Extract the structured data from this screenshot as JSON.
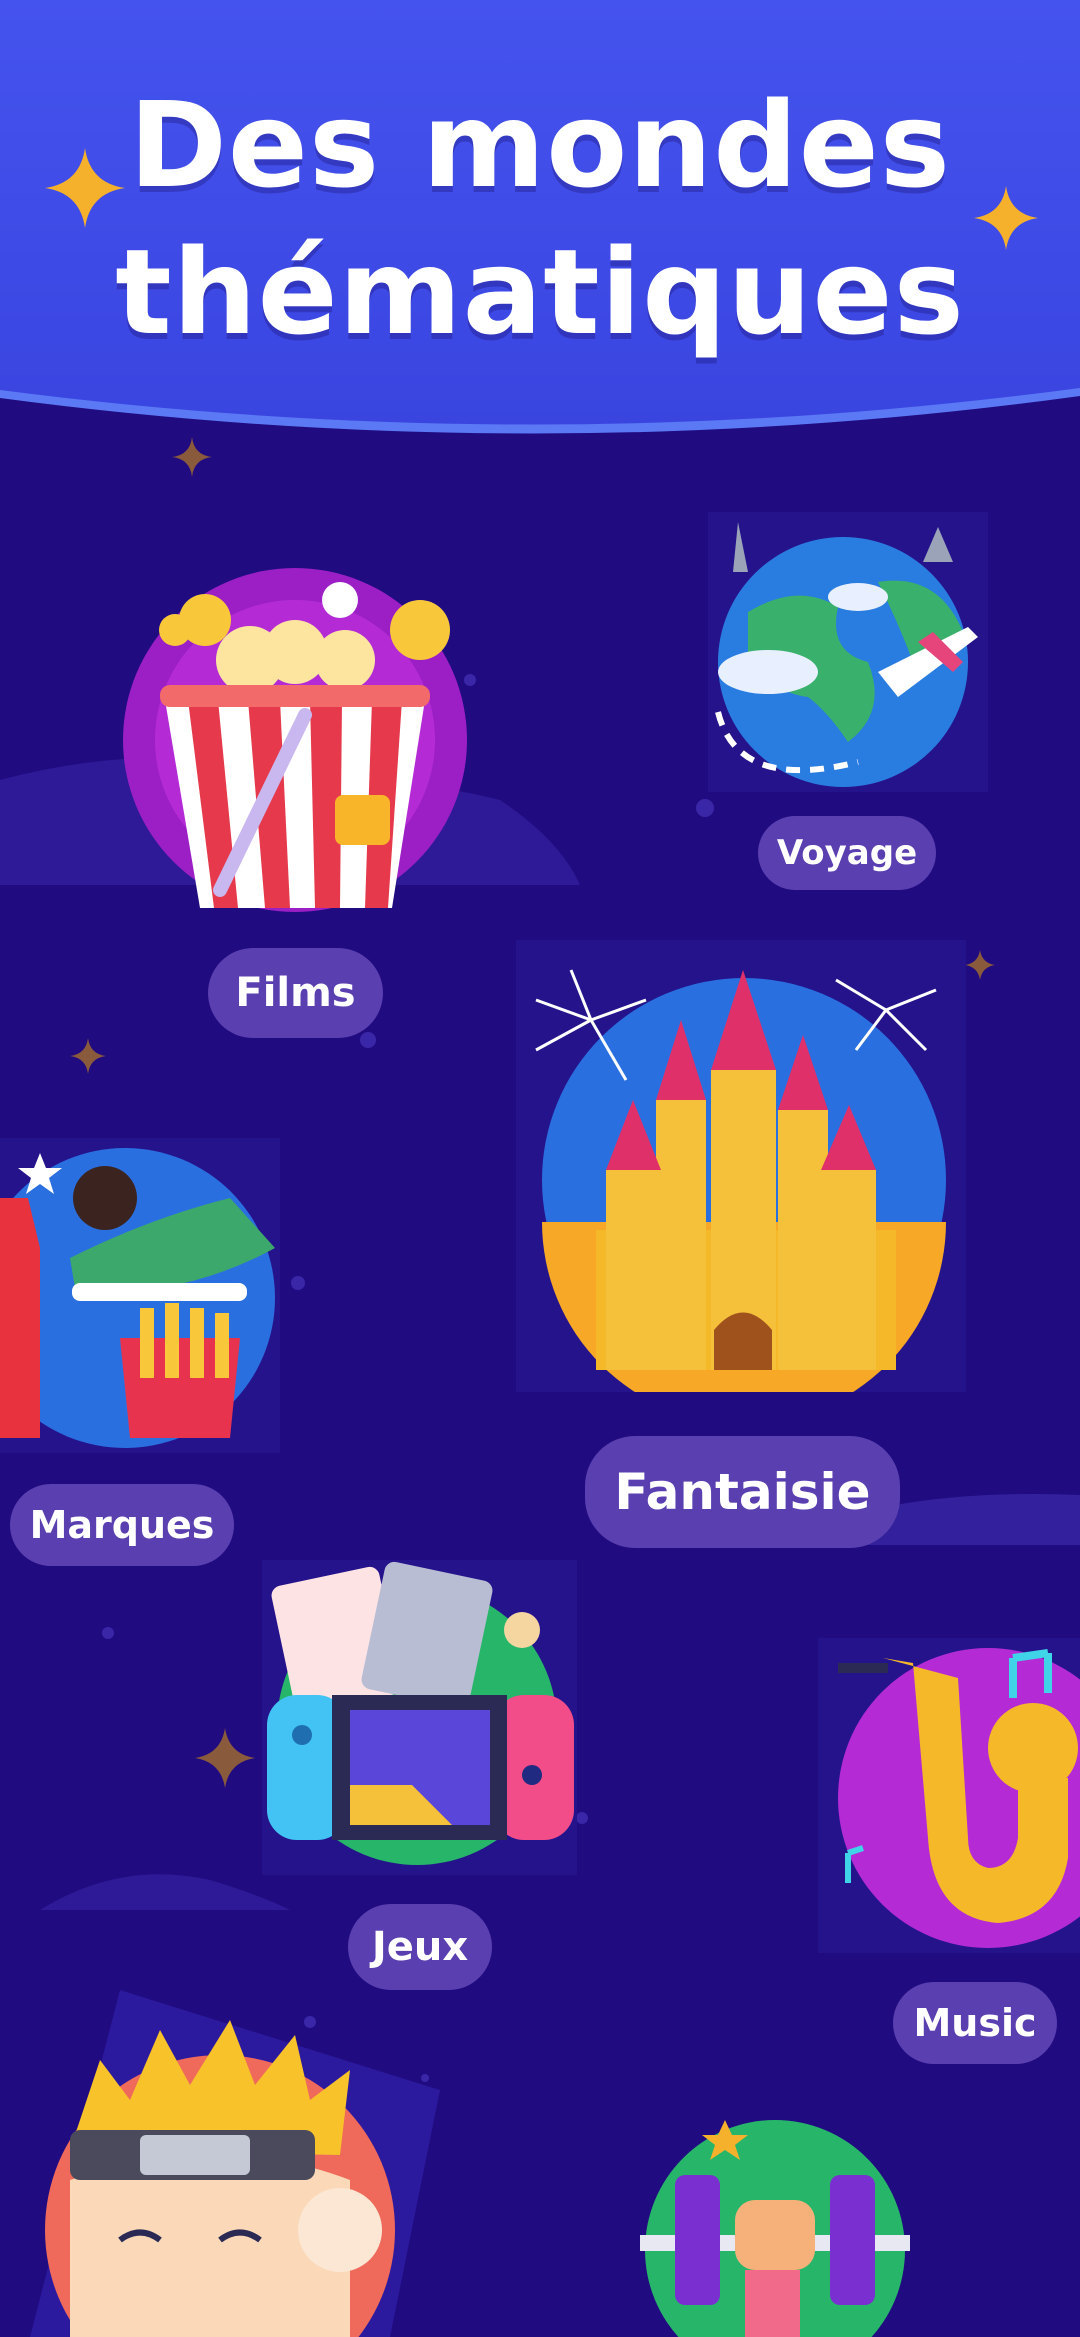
{
  "header": {
    "title_line1": "Des mondes",
    "title_line2": "thématiques"
  },
  "worlds": [
    {
      "label": "Films",
      "icon": "popcorn-icon"
    },
    {
      "label": "Voyage",
      "icon": "globe-airplane-icon"
    },
    {
      "label": "Fantaisie",
      "icon": "castle-icon"
    },
    {
      "label": "Marques",
      "icon": "brands-icon"
    },
    {
      "label": "Jeux",
      "icon": "game-console-icon"
    },
    {
      "label": "Music",
      "icon": "saxophone-icon"
    },
    {
      "label": "",
      "icon": "anime-character-icon"
    },
    {
      "label": "",
      "icon": "fitness-dumbbell-icon"
    }
  ],
  "colors": {
    "background": "#200b80",
    "header": "#3b4be8",
    "pill": "#5a3fb0",
    "star": "#f5b12b"
  }
}
